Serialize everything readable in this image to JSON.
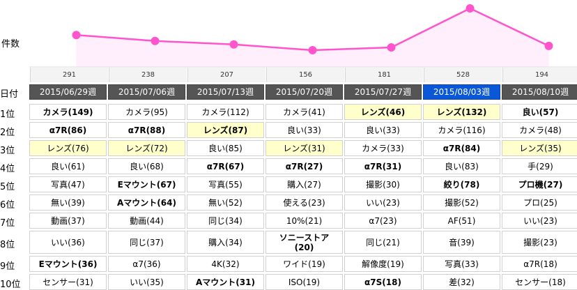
{
  "chart": {
    "ylabel": "件数",
    "counts": [
      "291",
      "238",
      "207",
      "156",
      "181",
      "528",
      "194"
    ],
    "colors": {
      "line": "#ff55cc",
      "fill": "#ffeefb",
      "point": "#ff55cc"
    }
  },
  "chart_data": {
    "type": "area",
    "title": "",
    "ylabel": "件数",
    "categories": [
      "2015/06/29週",
      "2015/07/06週",
      "2015/07/13週",
      "2015/07/20週",
      "2015/07/27週",
      "2015/08/03週",
      "2015/08/10週"
    ],
    "values": [
      291,
      238,
      207,
      156,
      181,
      528,
      194
    ]
  },
  "table": {
    "date_label": "日付",
    "weeks": [
      {
        "label": "2015/06/29週",
        "selected": false
      },
      {
        "label": "2015/07/06週",
        "selected": false
      },
      {
        "label": "2015/07/13週",
        "selected": false
      },
      {
        "label": "2015/07/20週",
        "selected": false
      },
      {
        "label": "2015/07/27週",
        "selected": false
      },
      {
        "label": "2015/08/03週",
        "selected": true
      },
      {
        "label": "2015/08/10週",
        "selected": false
      }
    ],
    "rank_labels": [
      "1位",
      "2位",
      "3位",
      "4位",
      "5位",
      "6位",
      "7位",
      "8位",
      "9位",
      "10位"
    ],
    "rows": [
      [
        {
          "t": "カメラ(149)",
          "b": true
        },
        {
          "t": "カメラ(95)"
        },
        {
          "t": "カメラ(112)"
        },
        {
          "t": "カメラ(41)"
        },
        {
          "t": "レンズ(46)",
          "b": true,
          "h": true
        },
        {
          "t": "レンズ(132)",
          "b": true,
          "h": true
        },
        {
          "t": "良い(57)",
          "b": true
        }
      ],
      [
        {
          "t": "α7R(86)",
          "b": true
        },
        {
          "t": "α7R(88)",
          "b": true
        },
        {
          "t": "レンズ(87)",
          "b": true,
          "h": true
        },
        {
          "t": "良い(33)"
        },
        {
          "t": "良い(33)"
        },
        {
          "t": "カメラ(116)"
        },
        {
          "t": "カメラ(48)"
        }
      ],
      [
        {
          "t": "レンズ(76)",
          "h": true
        },
        {
          "t": "レンズ(72)",
          "h": true
        },
        {
          "t": "良い(85)"
        },
        {
          "t": "レンズ(31)",
          "h": true
        },
        {
          "t": "カメラ(33)"
        },
        {
          "t": "α7R(84)",
          "b": true
        },
        {
          "t": "レンズ(35)",
          "h": true
        }
      ],
      [
        {
          "t": "良い(61)"
        },
        {
          "t": "良い(68)"
        },
        {
          "t": "α7R(67)",
          "b": true
        },
        {
          "t": "α7R(27)",
          "b": true
        },
        {
          "t": "α7R(31)",
          "b": true
        },
        {
          "t": "良い(83)"
        },
        {
          "t": "手(29)"
        }
      ],
      [
        {
          "t": "写真(47)"
        },
        {
          "t": "Eマウント(67)",
          "b": true
        },
        {
          "t": "写真(55)"
        },
        {
          "t": "購入(27)"
        },
        {
          "t": "撮影(30)"
        },
        {
          "t": "絞り(78)",
          "b": true
        },
        {
          "t": "プロ機(27)",
          "b": true
        }
      ],
      [
        {
          "t": "無い(39)"
        },
        {
          "t": "Aマウント(64)",
          "b": true
        },
        {
          "t": "無い(52)"
        },
        {
          "t": "使える(23)"
        },
        {
          "t": "いい(23)"
        },
        {
          "t": "撮影(52)"
        },
        {
          "t": "プロ(25)"
        }
      ],
      [
        {
          "t": "動画(37)"
        },
        {
          "t": "動画(44)"
        },
        {
          "t": "同じ(34)"
        },
        {
          "t": "10%(21)"
        },
        {
          "t": "α7(23)"
        },
        {
          "t": "AF(51)"
        },
        {
          "t": "いい(23)"
        }
      ],
      [
        {
          "t": "いい(36)"
        },
        {
          "t": "同じ(37)"
        },
        {
          "t": "購入(34)"
        },
        {
          "t": "ソニーストア(20)",
          "b": true
        },
        {
          "t": "同じ(21)"
        },
        {
          "t": "音(39)"
        },
        {
          "t": "撮影(23)"
        }
      ],
      [
        {
          "t": "Eマウント(36)",
          "b": true
        },
        {
          "t": "α7(36)"
        },
        {
          "t": "4K(32)"
        },
        {
          "t": "ワイド(19)"
        },
        {
          "t": "解像度(19)"
        },
        {
          "t": "写真(33)"
        },
        {
          "t": "α7R(18)"
        }
      ],
      [
        {
          "t": "センサー(31)"
        },
        {
          "t": "いい(35)"
        },
        {
          "t": "Aマウント(31)",
          "b": true
        },
        {
          "t": "ISO(19)"
        },
        {
          "t": "α7S(18)",
          "b": true
        },
        {
          "t": "差(32)"
        },
        {
          "t": "センサー(18)"
        }
      ]
    ]
  }
}
